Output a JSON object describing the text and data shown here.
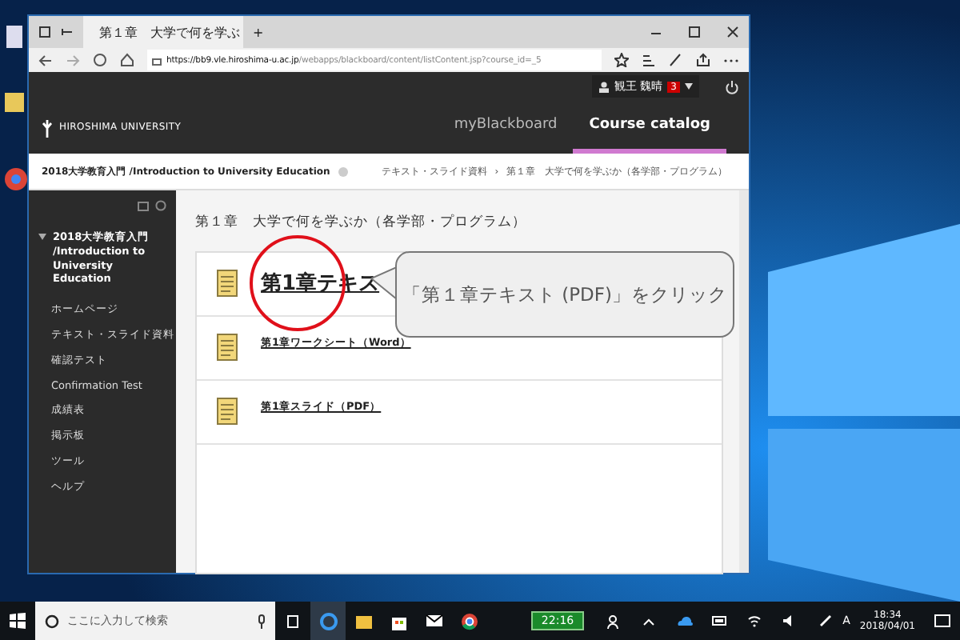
{
  "browser": {
    "tab_title": "第１章　大学で何を学ぶ",
    "new_tab": "+",
    "url_host": "https://bb9.vle.hiroshima-u.ac.jp",
    "url_path": "/webapps/blackboard/content/listContent.jsp?course_id=_5"
  },
  "header": {
    "user": "観王 魏晴",
    "notification_count": "3",
    "logo": "HIROSHIMA UNIVERSITY",
    "nav": [
      {
        "label": "myBlackboard",
        "selected": false
      },
      {
        "label": "Course catalog",
        "selected": true
      }
    ]
  },
  "breadcrumb": {
    "course": "2018大学教育入門 /Introduction to University Education",
    "separator": "›",
    "path": [
      "テキスト・スライド資料",
      "第１章　大学で何を学ぶか（各学部・プログラム）"
    ]
  },
  "sidebar": {
    "course_title": "2018大学教育入門 /Introduction to University Education",
    "items": [
      "ホームページ",
      "テキスト・スライド資料",
      "確認テスト",
      "Confirmation Test",
      "成績表",
      "掲示板",
      "ツール",
      "ヘルプ"
    ]
  },
  "content": {
    "heading": "第１章　大学で何を学ぶか（各学部・プログラム）",
    "items": [
      {
        "title": "第1章テキス",
        "highlighted": true
      },
      {
        "title": "第1章ワークシート（Word）",
        "highlighted": false
      },
      {
        "title": "第1章スライド（PDF）",
        "highlighted": false
      }
    ]
  },
  "annotation": {
    "callout": "「第１章テキスト (PDF)」をクリック"
  },
  "taskbar": {
    "search_placeholder": "ここに入力して検索",
    "badge": "22:16",
    "ime": "A",
    "time": "18:34",
    "date": "2018/04/01"
  }
}
